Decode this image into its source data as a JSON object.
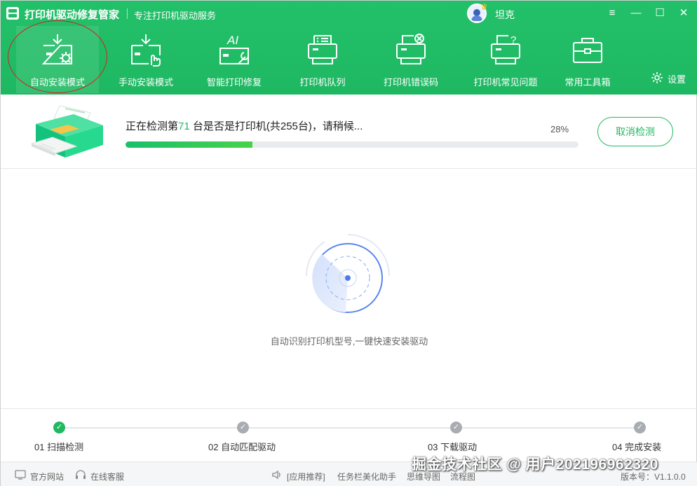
{
  "window": {
    "app_title": "打印机驱动修复管家",
    "app_subtitle": "专注打印机驱动服务",
    "username": "坦克",
    "controls": [
      "≡",
      "—",
      "☐",
      "✕"
    ]
  },
  "nav": {
    "items": [
      {
        "label": "自动安装模式",
        "icon": "auto-install-icon",
        "active": true
      },
      {
        "label": "手动安装模式",
        "icon": "manual-install-icon",
        "active": false
      },
      {
        "label": "智能打印修复",
        "icon": "ai-repair-icon",
        "active": false
      },
      {
        "label": "打印机队列",
        "icon": "printer-queue-icon",
        "active": false
      },
      {
        "label": "打印机错误码",
        "icon": "printer-error-icon",
        "active": false
      },
      {
        "label": "打印机常见问题",
        "icon": "printer-faq-icon",
        "active": false
      },
      {
        "label": "常用工具箱",
        "icon": "toolbox-icon",
        "active": false
      }
    ],
    "settings_label": "设置"
  },
  "detect": {
    "text_prefix": "正在检测第",
    "current": "71",
    "text_suffix": " 台是否是打印机(共255台)，请稍候...",
    "percent_label": "28%",
    "progress": 0.28,
    "cancel_label": "取消检测"
  },
  "radar": {
    "caption": "自动识别打印机型号,一键快速安装驱动"
  },
  "steps": [
    {
      "label": "01 扫描检测",
      "done": true
    },
    {
      "label": "02 自动匹配驱动",
      "done": false
    },
    {
      "label": "03 下载驱动",
      "done": false
    },
    {
      "label": "04 完成安装",
      "done": false
    }
  ],
  "statusbar": {
    "website": "官方网站",
    "service": "在线客服",
    "recommend": "[应用推荐]",
    "link1": "任务栏美化助手",
    "link2": "思维导图",
    "link3": "流程图",
    "version": "版本号：V1.1.0.0"
  },
  "watermark": "掘金技术社区 @ 用户2021969623​20",
  "colors": {
    "brand_green": "#21b85f",
    "header_green": "#1fb862",
    "highlight_ring": "#d62020",
    "radar_blue": "#4a7be6"
  }
}
